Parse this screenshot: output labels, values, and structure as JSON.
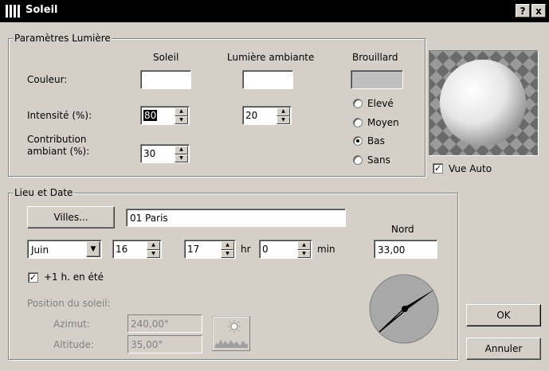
{
  "window": {
    "title": "Soleil",
    "help_label": "?",
    "close_label": "x"
  },
  "lumiere": {
    "legend": "Paramètres Lumière",
    "col_soleil": "Soleil",
    "col_ambiante": "Lumière ambiante",
    "col_brouillard": "Brouillard",
    "row_couleur": "Couleur:",
    "row_intensite": "Intensité (%):",
    "row_contribution": "Contribution\nambiant (%):",
    "soleil_intensite": "80",
    "ambiante_intensite": "20",
    "contribution": "30",
    "colors": {
      "soleil": "#ffffff",
      "ambiante": "#ffffff",
      "brouillard": "#c0c0c0"
    },
    "fog_options": [
      "Elevé",
      "Moyen",
      "Bas",
      "Sans"
    ],
    "fog_selected": "Bas",
    "vue_auto_label": "Vue Auto",
    "vue_auto_checked": true
  },
  "lieu": {
    "legend": "Lieu et Date",
    "villes_button": "Villes...",
    "city_value": "01 Paris",
    "month_value": "Juin",
    "day_value": "16",
    "hour_value": "17",
    "hour_unit": "hr",
    "min_value": "0",
    "min_unit": "min",
    "nord_label": "Nord",
    "nord_value": "33,00",
    "summer_time_label": "+1 h. en été",
    "summer_time_checked": true,
    "position_label": "Position du soleil:",
    "azimut_label": "Azimut:",
    "azimut_value": "240,00°",
    "altitude_label": "Altitude:",
    "altitude_value": "35,00°"
  },
  "buttons": {
    "ok": "OK",
    "cancel": "Annuler"
  }
}
